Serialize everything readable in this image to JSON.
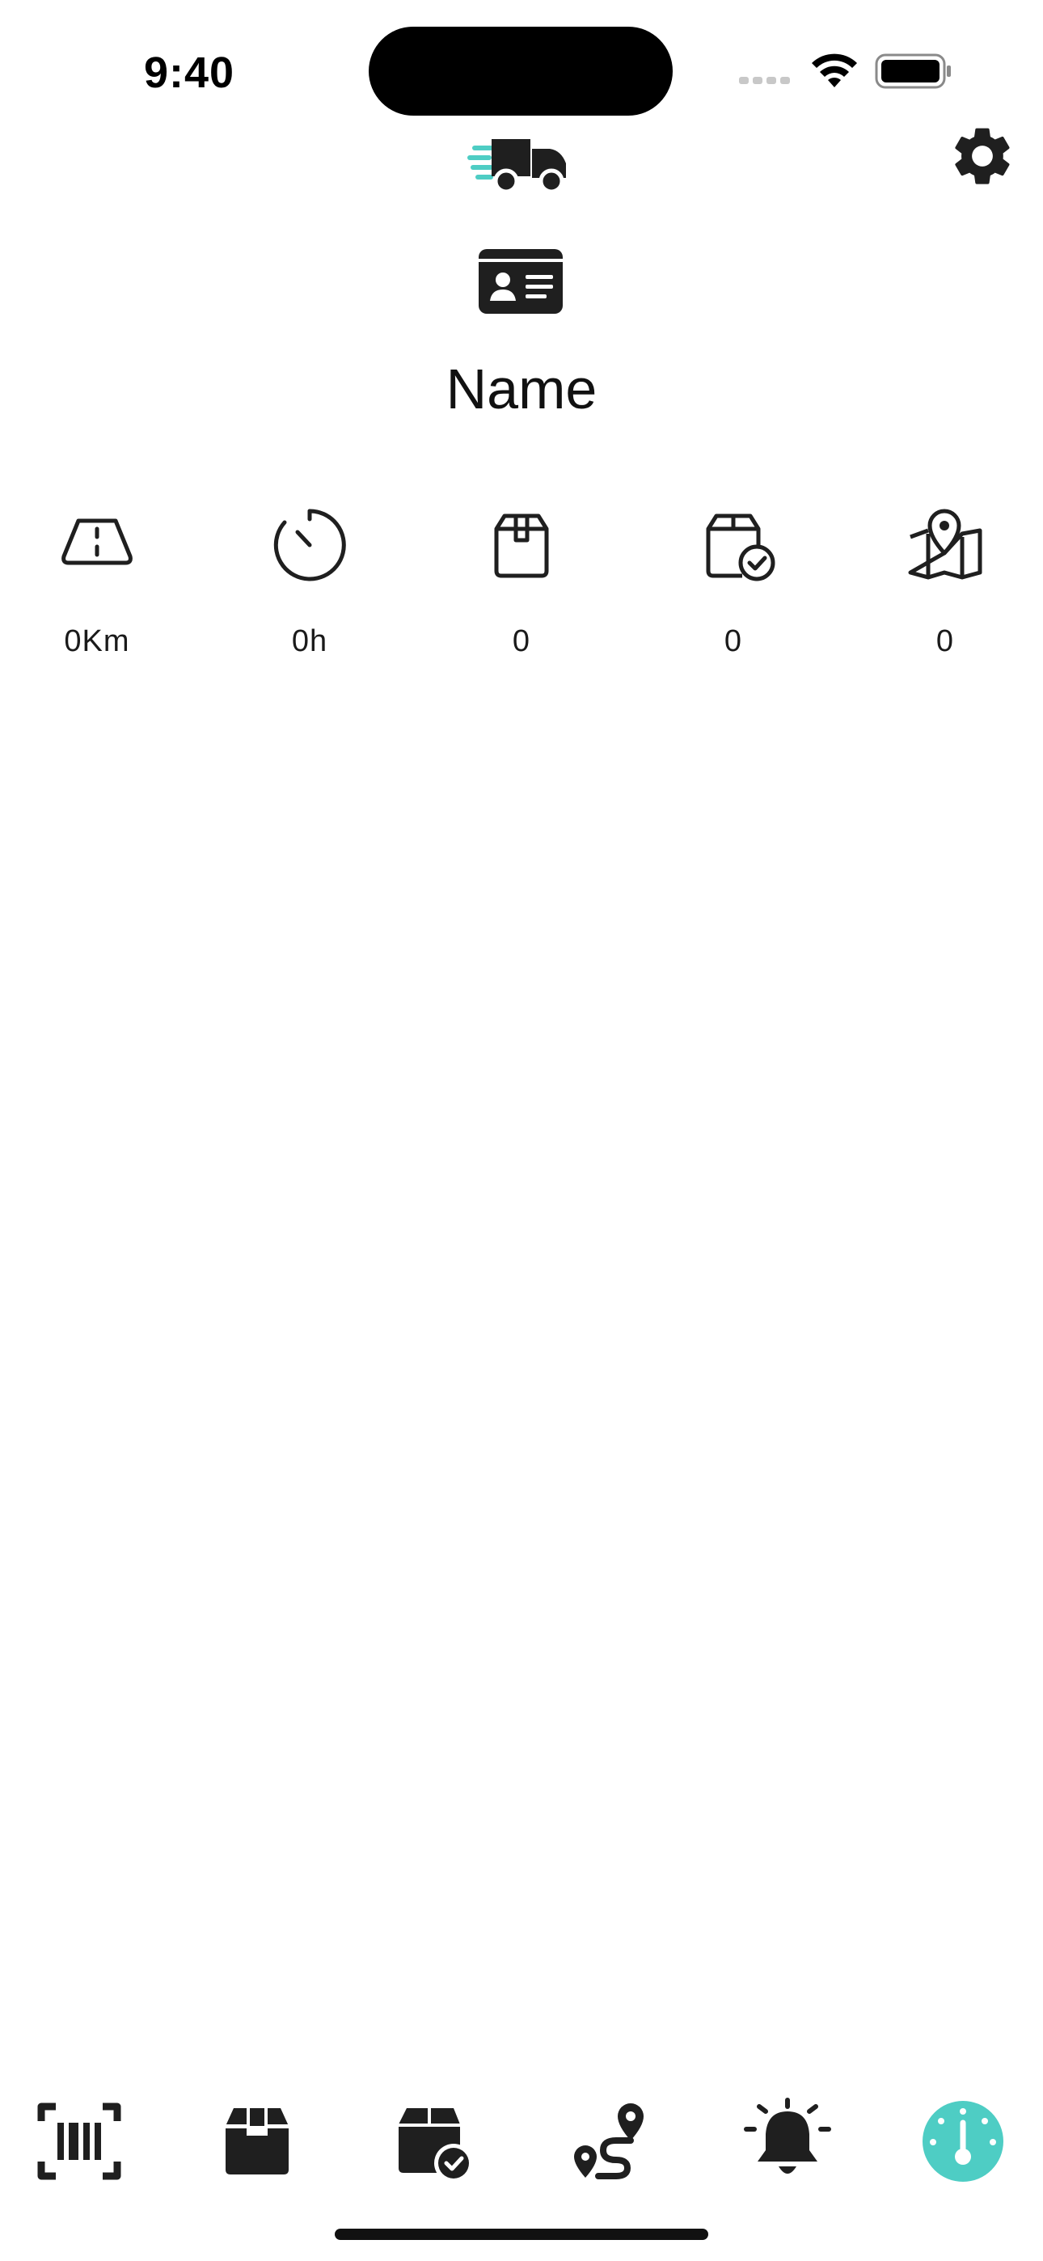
{
  "status_bar": {
    "time": "9:40"
  },
  "header": {
    "logo_icon": "truck-logo-icon",
    "settings_icon": "gear-icon",
    "profile_icon": "id-card-icon",
    "driver_name": "Name"
  },
  "stats": [
    {
      "icon": "road-icon",
      "value": "0Km"
    },
    {
      "icon": "timer-icon",
      "value": "0h"
    },
    {
      "icon": "package-icon",
      "value": "0"
    },
    {
      "icon": "package-check-icon",
      "value": "0"
    },
    {
      "icon": "map-pin-icon",
      "value": "0"
    }
  ],
  "tab_bar": {
    "tabs": [
      {
        "icon": "barcode-scan-icon",
        "active": false
      },
      {
        "icon": "package-icon",
        "active": false
      },
      {
        "icon": "delivered-package-icon",
        "active": false
      },
      {
        "icon": "route-icon",
        "active": false
      },
      {
        "icon": "alarm-bell-icon",
        "active": false
      },
      {
        "icon": "dashboard-gauge-icon",
        "active": true
      }
    ]
  },
  "colors": {
    "accent": "#4ecdc4",
    "icon_dark": "#1a1a1a",
    "background": "#ffffff"
  }
}
